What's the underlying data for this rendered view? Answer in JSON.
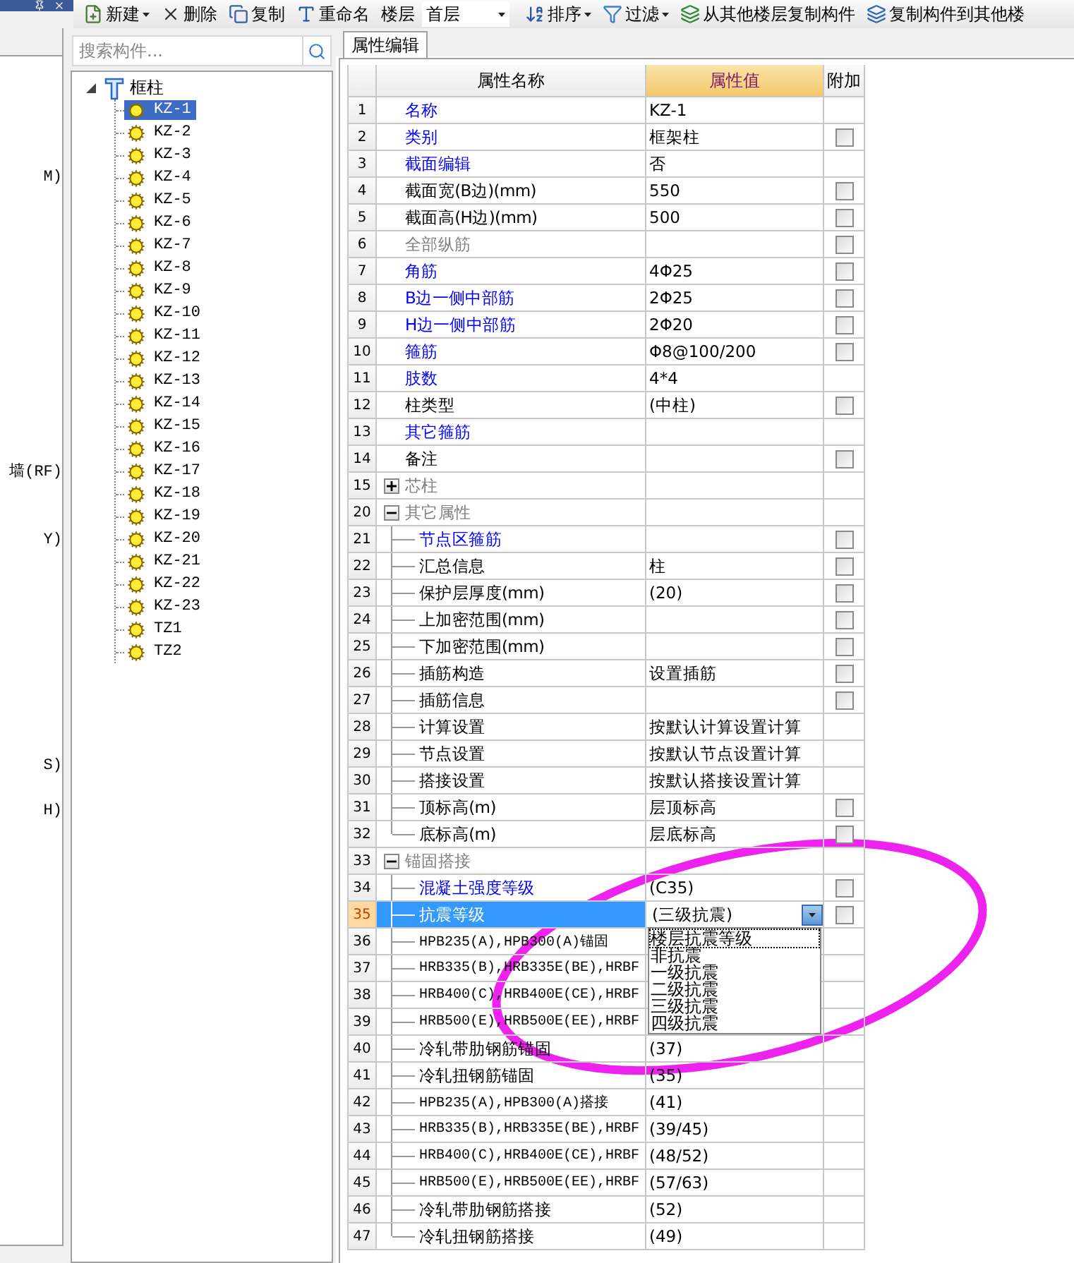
{
  "toolbar": {
    "buttons": [
      {
        "label": "新建",
        "menu": true
      },
      {
        "label": "删除",
        "menu": false
      },
      {
        "label": "复制",
        "menu": false
      },
      {
        "label": "重命名",
        "menu": false
      }
    ],
    "floor_label": "楼层",
    "floor_value": "首层",
    "tools": [
      {
        "label": "排序",
        "menu": true
      },
      {
        "label": "过滤",
        "menu": true
      },
      {
        "label": "从其他楼层复制构件",
        "menu": false
      },
      {
        "label": "复制构件到其他楼",
        "menu": false
      }
    ]
  },
  "left_panel": {
    "items": [
      "M)",
      "墙(RF)",
      "Y)",
      "S)",
      "H)"
    ]
  },
  "search": {
    "placeholder": "搜索构件..."
  },
  "tree": {
    "label": "框柱",
    "expanded": true,
    "children": [
      {
        "label": "KZ-1",
        "selected": true
      },
      {
        "label": "KZ-2",
        "selected": false
      },
      {
        "label": "KZ-3",
        "selected": false
      },
      {
        "label": "KZ-4",
        "selected": false
      },
      {
        "label": "KZ-5",
        "selected": false
      },
      {
        "label": "KZ-6",
        "selected": false
      },
      {
        "label": "KZ-7",
        "selected": false
      },
      {
        "label": "KZ-8",
        "selected": false
      },
      {
        "label": "KZ-9",
        "selected": false
      },
      {
        "label": "KZ-10",
        "selected": false
      },
      {
        "label": "KZ-11",
        "selected": false
      },
      {
        "label": "KZ-12",
        "selected": false
      },
      {
        "label": "KZ-13",
        "selected": false
      },
      {
        "label": "KZ-14",
        "selected": false
      },
      {
        "label": "KZ-15",
        "selected": false
      },
      {
        "label": "KZ-16",
        "selected": false
      },
      {
        "label": "KZ-17",
        "selected": false
      },
      {
        "label": "KZ-18",
        "selected": false
      },
      {
        "label": "KZ-19",
        "selected": false
      },
      {
        "label": "KZ-20",
        "selected": false
      },
      {
        "label": "KZ-21",
        "selected": false
      },
      {
        "label": "KZ-22",
        "selected": false
      },
      {
        "label": "KZ-23",
        "selected": false
      },
      {
        "label": "TZ1",
        "selected": false
      },
      {
        "label": "TZ2",
        "selected": false
      }
    ]
  },
  "tabs": [
    {
      "label": "属性编辑",
      "selected": true
    }
  ],
  "table": {
    "columns": [
      "属性名称",
      "属性值",
      "附加"
    ],
    "rows": [
      {
        "n": "1",
        "name": "名称",
        "value": "KZ-1",
        "kind": "item",
        "color": "#0000ff",
        "selected": false
      },
      {
        "n": "2",
        "name": "类别",
        "value": "框架柱",
        "kind": "item",
        "color": "#0000ff",
        "checked": false,
        "selected": false
      },
      {
        "n": "3",
        "name": "截面编辑",
        "value": "否",
        "kind": "item",
        "color": "#0000ff",
        "selected": false
      },
      {
        "n": "4",
        "name": "截面宽(B边)(mm)",
        "value": "550",
        "kind": "item",
        "color": "#000000",
        "checked": false,
        "selected": false
      },
      {
        "n": "5",
        "name": "截面高(H边)(mm)",
        "value": "500",
        "kind": "item",
        "color": "#000000",
        "checked": false,
        "selected": false
      },
      {
        "n": "6",
        "name": "全部纵筋",
        "kind": "item",
        "color": "#808080",
        "checked": false,
        "selected": false
      },
      {
        "n": "7",
        "name": "角筋",
        "value": "4Φ25",
        "kind": "item",
        "color": "#0000ff",
        "checked": false,
        "selected": false
      },
      {
        "n": "8",
        "name": "B边一侧中部筋",
        "value": "2Φ25",
        "kind": "item",
        "color": "#0000ff",
        "checked": false,
        "selected": false
      },
      {
        "n": "9",
        "name": "H边一侧中部筋",
        "value": "2Φ20",
        "kind": "item",
        "color": "#0000ff",
        "checked": false,
        "selected": false
      },
      {
        "n": "10",
        "name": "箍筋",
        "value": "Φ8@100/200",
        "kind": "item",
        "color": "#0000ff",
        "checked": false,
        "selected": false
      },
      {
        "n": "11",
        "name": "肢数",
        "value": "4*4",
        "kind": "item",
        "color": "#0000ff",
        "selected": false
      },
      {
        "n": "12",
        "name": "柱类型",
        "value": "(中柱)",
        "kind": "item",
        "color": "#000000",
        "checked": false,
        "selected": false
      },
      {
        "n": "13",
        "name": "其它箍筋",
        "kind": "item",
        "color": "#0000ff",
        "selected": false
      },
      {
        "n": "14",
        "name": "备注",
        "kind": "item",
        "color": "#000000",
        "checked": false,
        "selected": false
      },
      {
        "n": "15",
        "name": "芯柱",
        "kind": "group",
        "color": "#808080",
        "expanded": false,
        "selected": false
      },
      {
        "n": "20",
        "name": "其它属性",
        "kind": "group",
        "color": "#808080",
        "expanded": true,
        "selected": false
      },
      {
        "n": "21",
        "name": "节点区箍筋",
        "kind": "child",
        "color": "#0000ff",
        "checked": false,
        "selected": false
      },
      {
        "n": "22",
        "name": "汇总信息",
        "value": "柱",
        "kind": "child",
        "color": "#000000",
        "checked": false,
        "selected": false
      },
      {
        "n": "23",
        "name": "保护层厚度(mm)",
        "value": "(20)",
        "kind": "child",
        "color": "#000000",
        "checked": false,
        "selected": false
      },
      {
        "n": "24",
        "name": "上加密范围(mm)",
        "kind": "child",
        "color": "#000000",
        "checked": false,
        "selected": false
      },
      {
        "n": "25",
        "name": "下加密范围(mm)",
        "kind": "child",
        "color": "#000000",
        "checked": false,
        "selected": false
      },
      {
        "n": "26",
        "name": "插筋构造",
        "value": "设置插筋",
        "kind": "child",
        "color": "#000000",
        "checked": false,
        "selected": false
      },
      {
        "n": "27",
        "name": "插筋信息",
        "kind": "child",
        "color": "#000000",
        "checked": false,
        "selected": false
      },
      {
        "n": "28",
        "name": "计算设置",
        "value": "按默认计算设置计算",
        "kind": "child",
        "color": "#000000",
        "selected": false
      },
      {
        "n": "29",
        "name": "节点设置",
        "value": "按默认节点设置计算",
        "kind": "child",
        "color": "#000000",
        "selected": false
      },
      {
        "n": "30",
        "name": "搭接设置",
        "value": "按默认搭接设置计算",
        "kind": "child",
        "color": "#000000",
        "selected": false
      },
      {
        "n": "31",
        "name": "顶标高(m)",
        "value": "层顶标高",
        "kind": "child",
        "color": "#000000",
        "checked": false,
        "selected": false
      },
      {
        "n": "32",
        "name": "底标高(m)",
        "value": "层底标高",
        "kind": "child",
        "color": "#000000",
        "checked": false,
        "selected": false
      },
      {
        "n": "33",
        "name": "锚固搭接",
        "kind": "group",
        "color": "#808080",
        "expanded": true,
        "selected": false
      },
      {
        "n": "34",
        "name": "混凝土强度等级",
        "value": "(C35)",
        "kind": "child",
        "color": "#0000ff",
        "checked": false,
        "selected": false
      },
      {
        "n": "35",
        "name": "抗震等级",
        "value": "(三级抗震)",
        "kind": "child",
        "checked": false,
        "selected": true,
        "dropdown": {
          "open": true,
          "options": [
            {
              "label": "楼层抗震等级",
              "focused": true
            },
            {
              "label": "非抗震",
              "focused": false
            },
            {
              "label": "一级抗震",
              "focused": false
            },
            {
              "label": "二级抗震",
              "focused": false
            },
            {
              "label": "三级抗震",
              "focused": false
            },
            {
              "label": "四级抗震",
              "focused": false
            }
          ]
        }
      },
      {
        "n": "36",
        "name": "HPB235(A),HPB300(A)锚固",
        "kind": "child",
        "color": "#000000",
        "selected": false
      },
      {
        "n": "37",
        "name": "HRB335(B),HRB335E(BE),HRBF",
        "kind": "child",
        "color": "#000000",
        "selected": false
      },
      {
        "n": "38",
        "name": "HRB400(C),HRB400E(CE),HRBF",
        "kind": "child",
        "color": "#000000",
        "selected": false
      },
      {
        "n": "39",
        "name": "HRB500(E),HRB500E(EE),HRBF",
        "kind": "child",
        "color": "#000000",
        "selected": false
      },
      {
        "n": "40",
        "name": "冷轧带肋钢筋锚固",
        "value": "(37)",
        "kind": "child",
        "color": "#000000",
        "selected": false
      },
      {
        "n": "41",
        "name": "冷轧扭钢筋锚固",
        "value": "(35)",
        "kind": "child",
        "color": "#000000",
        "selected": false
      },
      {
        "n": "42",
        "name": "HPB235(A),HPB300(A)搭接",
        "value": "(41)",
        "kind": "child",
        "color": "#000000",
        "selected": false
      },
      {
        "n": "43",
        "name": "HRB335(B),HRB335E(BE),HRBF",
        "value": "(39/45)",
        "kind": "child",
        "color": "#000000",
        "selected": false
      },
      {
        "n": "44",
        "name": "HRB400(C),HRB400E(CE),HRBF",
        "value": "(48/52)",
        "kind": "child",
        "color": "#000000",
        "selected": false
      },
      {
        "n": "45",
        "name": "HRB500(E),HRB500E(EE),HRBF",
        "value": "(57/63)",
        "kind": "child",
        "color": "#000000",
        "selected": false
      },
      {
        "n": "46",
        "name": "冷轧带肋钢筋搭接",
        "value": "(52)",
        "kind": "child",
        "color": "#000000",
        "selected": false
      },
      {
        "n": "47",
        "name": "冷轧扭钢筋搭接",
        "value": "(49)",
        "kind": "child",
        "color": "#000000",
        "selected": false
      }
    ]
  }
}
